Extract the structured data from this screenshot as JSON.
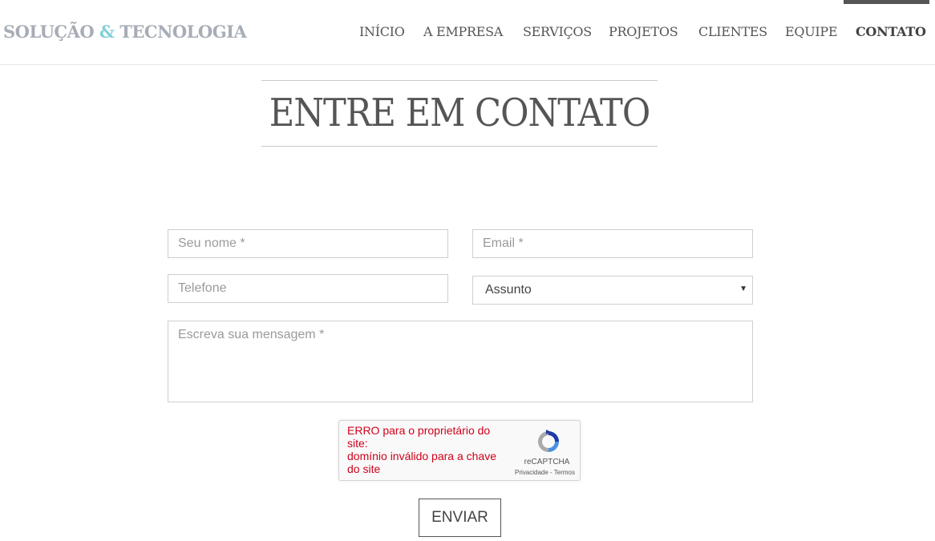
{
  "header": {
    "brand_part1": "SOLUÇÃO",
    "brand_amp": "&",
    "brand_part2": "TECNOLOGIA",
    "nav": [
      {
        "label": "INÍCIO"
      },
      {
        "label": "A EMPRESA"
      },
      {
        "label": "SERVIÇOS"
      },
      {
        "label": "PROJETOS"
      },
      {
        "label": "CLIENTES"
      },
      {
        "label": "EQUIPE"
      },
      {
        "label": "CONTATO",
        "active": true
      }
    ]
  },
  "page": {
    "title": "ENTRE EM CONTATO"
  },
  "form": {
    "name_placeholder": "Seu nome *",
    "email_placeholder": "Email *",
    "phone_placeholder": "Telefone",
    "subject_value": "Assunto",
    "message_placeholder": "Escreva sua mensagem *",
    "submit_label": "ENVIAR"
  },
  "captcha": {
    "error_line1": "ERRO para o proprietário do site:",
    "error_line2": "domínio inválido para a chave do site",
    "brand": "reCAPTCHA",
    "privacy": "Privacidade",
    "separator": " - ",
    "terms": "Termos"
  },
  "colors": {
    "brand_gray": "#a7adb6",
    "brand_accent": "#7fd0d8",
    "error_red": "#d0021b"
  }
}
